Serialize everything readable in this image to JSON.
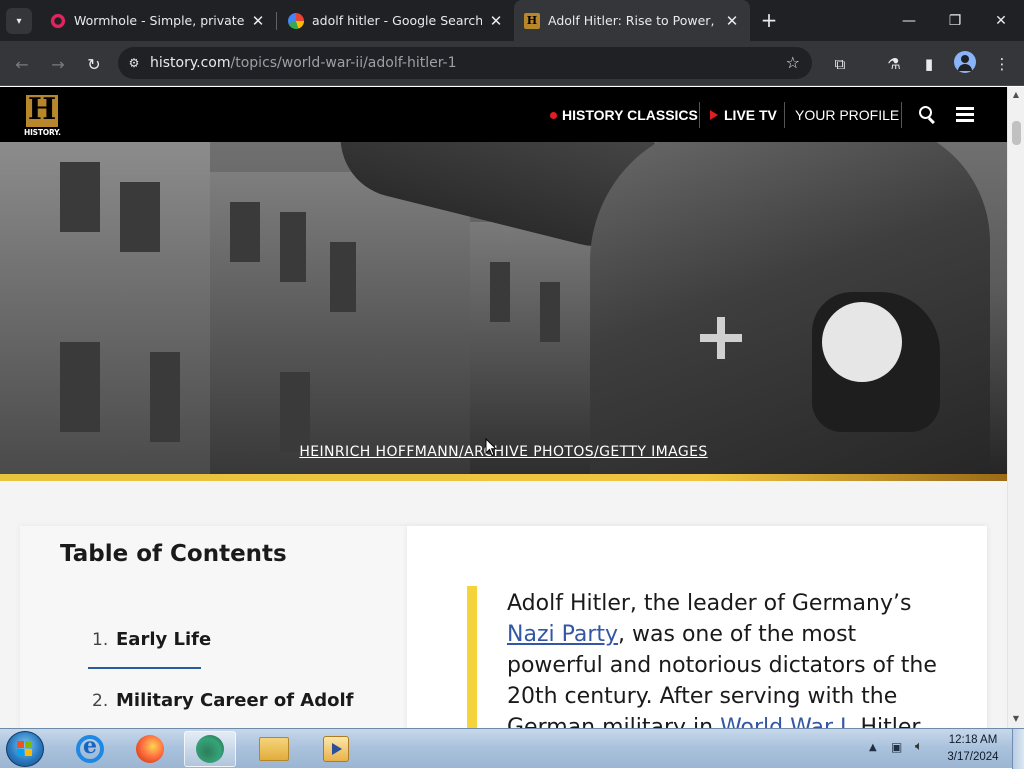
{
  "browser": {
    "tabs": [
      {
        "title": "Wormhole - Simple, private file",
        "active": false
      },
      {
        "title": "adolf hitler - Google Search",
        "active": false
      },
      {
        "title": "Adolf Hitler: Rise to Power, Imp",
        "active": true
      }
    ],
    "url_host": "history.com",
    "url_path": "/topics/world-war-ii/adolf-hitler-1"
  },
  "site": {
    "logo_text": "HISTORY.",
    "nav": {
      "classics": "HISTORY CLASSICS",
      "live_tv": "LIVE TV",
      "profile": "YOUR PROFILE"
    }
  },
  "hero": {
    "credit": "HEINRICH HOFFMANN/ARCHIVE PHOTOS/GETTY IMAGES"
  },
  "toc": {
    "title": "Table of Contents",
    "items": [
      {
        "num": "1.",
        "label": "Early Life"
      },
      {
        "num": "2.",
        "label": "Military Career of Adolf"
      }
    ]
  },
  "article": {
    "text_1": "Adolf Hitler, the leader of Germany’s ",
    "link_1": "Nazi Party",
    "text_2": ", was one of the most powerful and notorious dictators of the 20th century. After serving with the German military in ",
    "link_2": "World War I",
    "text_3": ", Hitler"
  },
  "taskbar": {
    "time": "12:18 AM",
    "date": "3/17/2024"
  },
  "colors": {
    "accent_gold": "#f0c440",
    "link_blue": "#3357a5",
    "live_red": "#e31b23"
  }
}
